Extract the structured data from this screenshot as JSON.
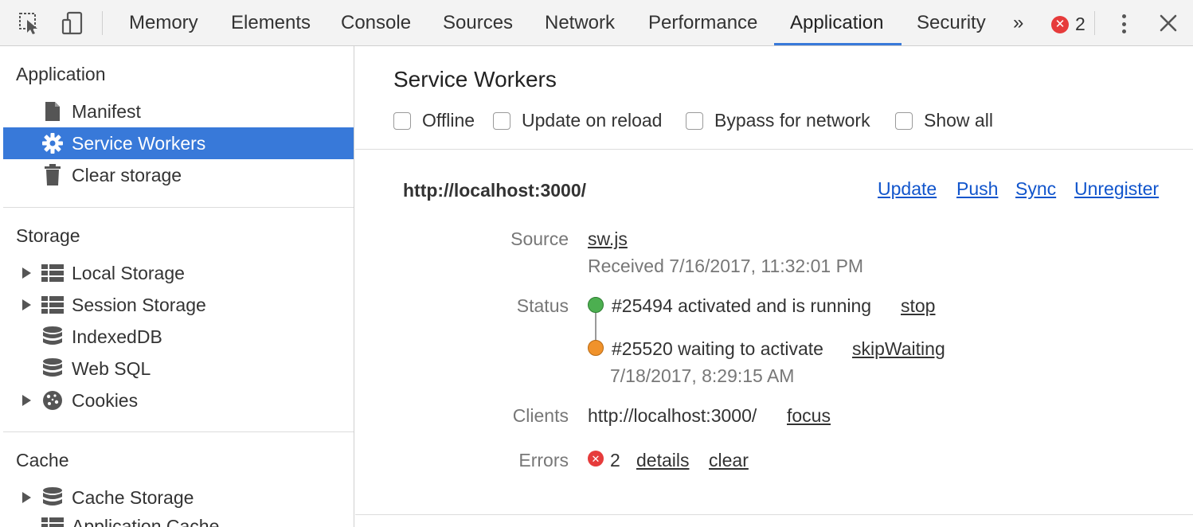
{
  "toolbar": {
    "tabs": [
      "Memory",
      "Elements",
      "Console",
      "Sources",
      "Network",
      "Performance",
      "Application",
      "Security"
    ],
    "active_tab": "Application",
    "more_tabs": "»",
    "error_count": "2",
    "accent_color": "#3879d9"
  },
  "sidebar": {
    "application": {
      "title": "Application",
      "items": [
        {
          "label": "Manifest",
          "icon": "document-icon"
        },
        {
          "label": "Service Workers",
          "icon": "gear-icon",
          "selected": true
        },
        {
          "label": "Clear storage",
          "icon": "trash-icon"
        }
      ]
    },
    "storage": {
      "title": "Storage",
      "items": [
        {
          "label": "Local Storage",
          "icon": "grid-icon",
          "expandable": true
        },
        {
          "label": "Session Storage",
          "icon": "grid-icon",
          "expandable": true
        },
        {
          "label": "IndexedDB",
          "icon": "database-icon"
        },
        {
          "label": "Web SQL",
          "icon": "database-icon"
        },
        {
          "label": "Cookies",
          "icon": "cookie-icon",
          "expandable": true
        }
      ]
    },
    "cache": {
      "title": "Cache",
      "items": [
        {
          "label": "Cache Storage",
          "icon": "database-icon",
          "expandable": true
        },
        {
          "label": "Application Cache",
          "icon": "grid-icon"
        }
      ]
    }
  },
  "main": {
    "title": "Service Workers",
    "checkboxes": [
      "Offline",
      "Update on reload",
      "Bypass for network",
      "Show all"
    ],
    "worker": {
      "origin": "http://localhost:3000/",
      "actions": [
        "Update",
        "Push",
        "Sync",
        "Unregister"
      ],
      "source_label": "Source",
      "source_link": "sw.js",
      "received": "Received 7/16/2017, 11:32:01 PM",
      "status_label": "Status",
      "status_running": "#25494 activated and is running",
      "status_running_color": "#4caf50",
      "stop_link": "stop",
      "status_waiting": "#25520 waiting to activate",
      "status_waiting_color": "#f0922b",
      "skip_link": "skipWaiting",
      "waiting_time": "7/18/2017, 8:29:15 AM",
      "clients_label": "Clients",
      "client_url": "http://localhost:3000/",
      "focus_link": "focus",
      "errors_label": "Errors",
      "error_count": "2",
      "details_link": "details",
      "clear_link": "clear"
    }
  }
}
